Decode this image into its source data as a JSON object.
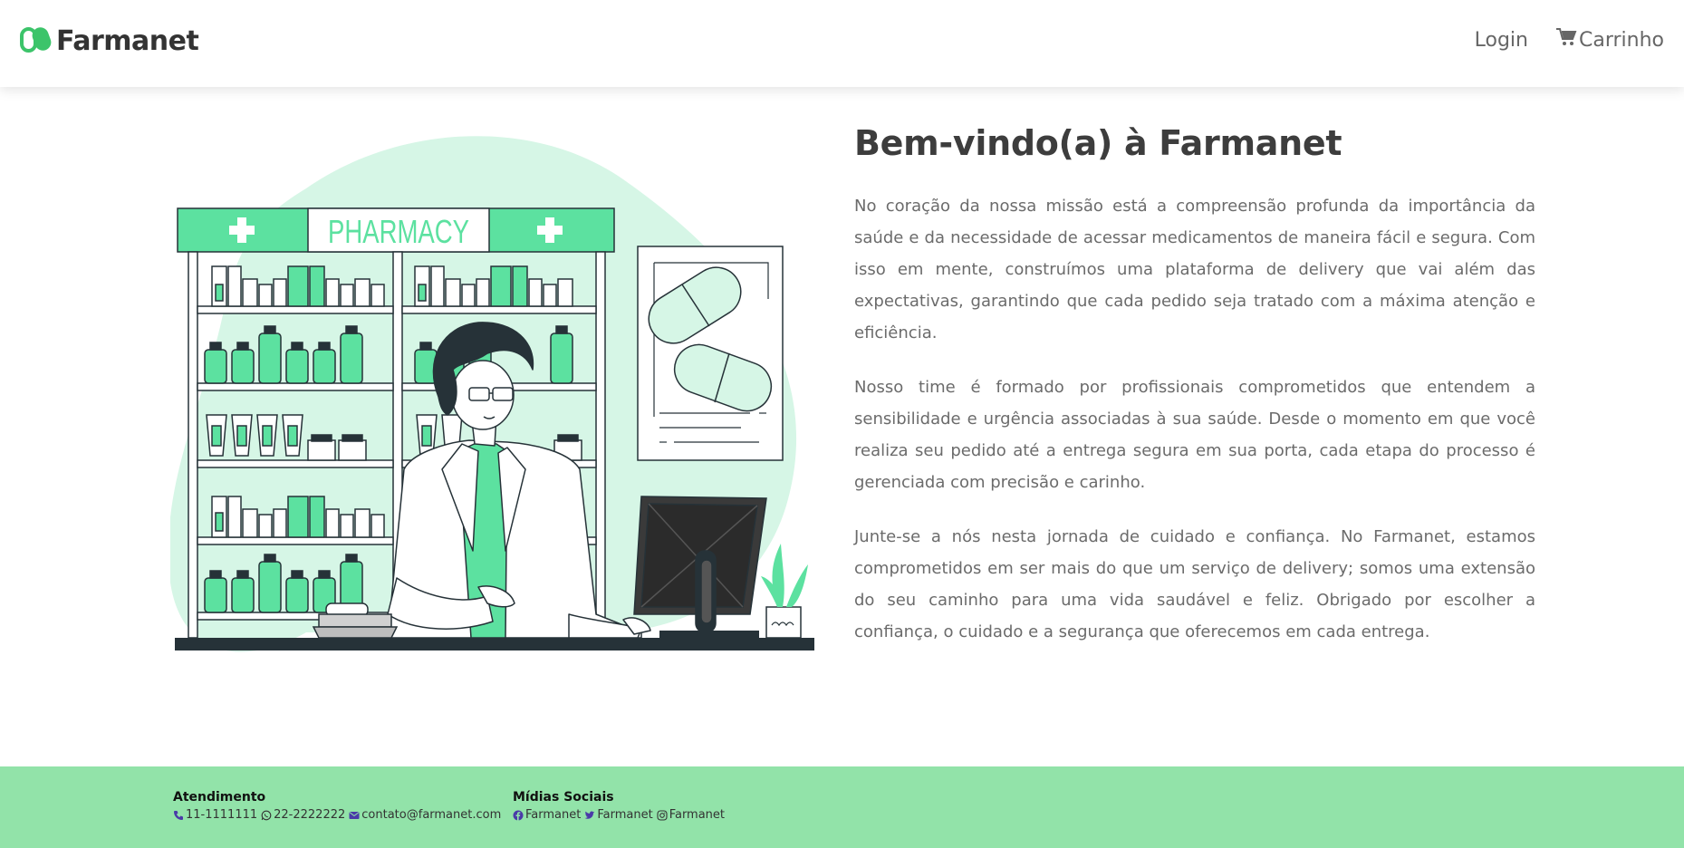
{
  "header": {
    "brand": "Farmanet",
    "nav": {
      "login": "Login",
      "cart": "Carrinho"
    }
  },
  "illustration": {
    "sign": "PHARMACY"
  },
  "main": {
    "title": "Bem-vindo(a) à Farmanet",
    "paragraphs": [
      "No coração da nossa missão está a compreensão profunda da importância da saúde e da necessidade de acessar medicamentos de maneira fácil e segura. Com isso em mente, construímos uma plataforma de delivery que vai além das expectativas, garantindo que cada pedido seja tratado com a máxima atenção e eficiência.",
      "Nosso time é formado por profissionais comprometidos que entendem a sensibilidade e urgência associadas à sua saúde. Desde o momento em que você realiza seu pedido até a entrega segura em sua porta, cada etapa do processo é gerenciada com precisão e carinho.",
      "Junte-se a nós nesta jornada de cuidado e confiança. No Farmanet, estamos comprometidos em ser mais do que um serviço de delivery; somos uma extensão do seu caminho para uma vida saudável e feliz. Obrigado por escolher a confiança, o cuidado e a segurança que oferecemos em cada entrega."
    ]
  },
  "footer": {
    "atendimento": {
      "title": "Atendimento",
      "phone": "11-1111111",
      "whatsapp": "22-2222222",
      "email": "contato@farmanet.com"
    },
    "social": {
      "title": "Mídias Sociais",
      "facebook": "Farmanet",
      "twitter": "Farmanet",
      "instagram": "Farmanet"
    }
  },
  "colors": {
    "accent": "#5ce1a0",
    "footer_bg": "#92e3a9",
    "dark": "#263238",
    "blob": "#d6f6e6",
    "icon_purple": "#4a3aa8"
  }
}
